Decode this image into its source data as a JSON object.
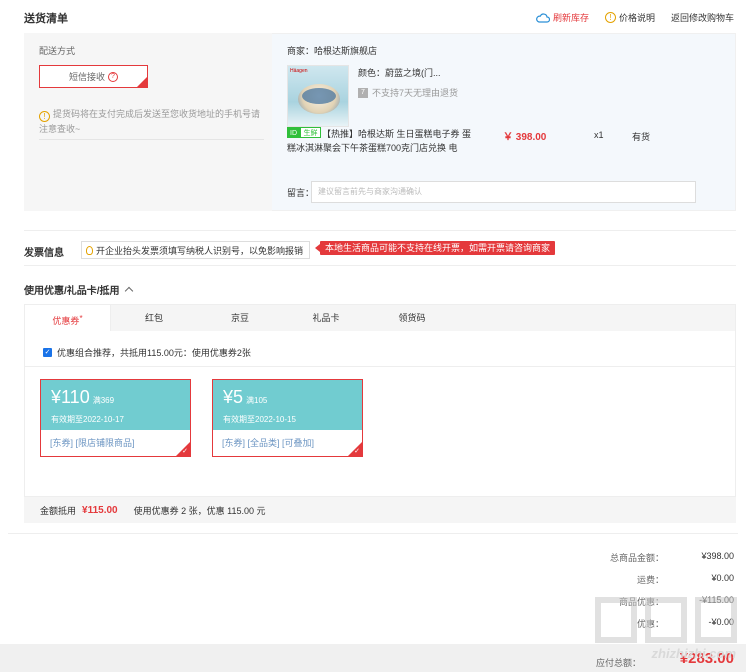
{
  "section_title": "送货清单",
  "top_links": {
    "refresh_stock": "刷新库存",
    "price_info": "价格说明",
    "back_to_cart": "返回修改购物车"
  },
  "delivery": {
    "method_label": "配送方式",
    "method_value": "短信接收",
    "tip": "提货码将在支付完成后发送至您收货地址的手机号请注意查收~",
    "merchant": "商家：哈根达斯旗舰店",
    "item": {
      "color": "颜色：蔚蓝之境(门...",
      "no_return": "不支持7天无理由退货",
      "tag_a": "ID",
      "tag_b": "生鲜",
      "name": "【热推】哈根达斯 生日蛋糕电子券 蛋糕冰淇淋聚会下午茶蛋糕700克门店兑换 电",
      "price": "￥ 398.00",
      "qty": "x1",
      "stock": "有货"
    },
    "remark_label": "留言：",
    "remark_placeholder": "建议留言前先与商家沟通确认"
  },
  "invoice": {
    "label": "发票信息",
    "tip": "开企业抬头发票须填写纳税人识别号，以免影响报销",
    "warning": "本地生活商品可能不支持在线开票，如需开票请咨询商家"
  },
  "coupons": {
    "title": "使用优惠/礼品卡/抵用",
    "tabs": [
      "优惠券",
      "红包",
      "京豆",
      "礼品卡",
      "领货码"
    ],
    "combo_text": "优惠组合推荐，共抵用115.00元：使用优惠券2张",
    "list": [
      {
        "amount": "¥110",
        "cond": "满369",
        "expire": "有效期至2022-10-17",
        "scope": "[东券] [限店铺限商品]"
      },
      {
        "amount": "¥5",
        "cond": "满105",
        "expire": "有效期至2022-10-15",
        "scope": "[东券] [全品类] [可叠加]"
      }
    ],
    "summary_label": "金额抵用",
    "summary_value": "¥115.00",
    "summary_detail": "使用优惠券 2 张，优惠 115.00 元"
  },
  "totals": {
    "goods_label": "总商品金额：",
    "goods_value": "¥398.00",
    "freight_label": "运费：",
    "freight_value": "¥0.00",
    "discount_label": "商品优惠：",
    "discount_value": "-¥115.00",
    "coupon_label": "优惠：",
    "coupon_value": "-¥0.00",
    "pay_label": "应付总额：",
    "pay_value": "¥283.00"
  },
  "watermark": "zhizhizhi.com",
  "colors": {
    "accent_red": "#e4393c",
    "coupon_teal": "#71ccd0",
    "link_blue": "#005ea7"
  }
}
